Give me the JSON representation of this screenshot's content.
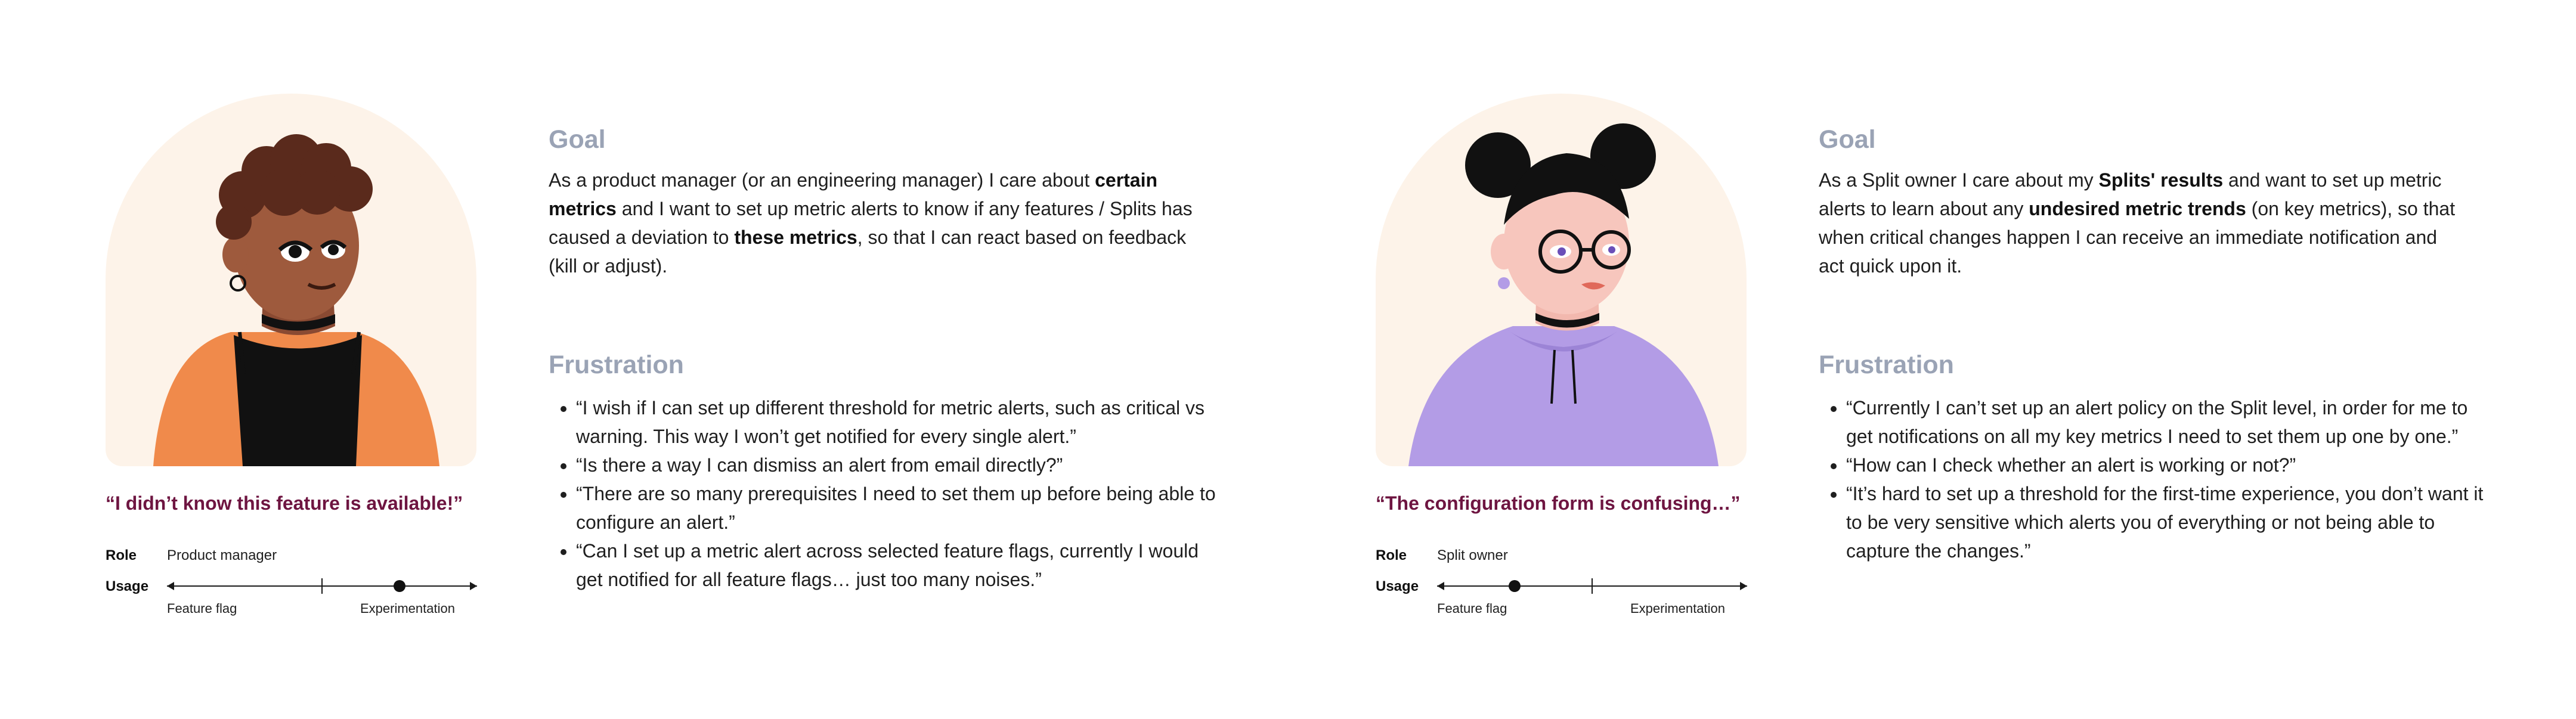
{
  "personas": [
    {
      "quote": "“I didn’t know this feature is available!”",
      "role_label": "Role",
      "role_value": "Product manager",
      "usage_label": "Usage",
      "usage_scale": {
        "left": "Feature flag",
        "right": "Experimentation",
        "position": 0.75
      },
      "goal_heading": "Goal",
      "goal_parts": {
        "t1": "As a product manager (or an engineering manager) I care about ",
        "b1": "certain metrics",
        "t2": " and I want to set up metric alerts to know if any features / Splits has caused a deviation to ",
        "b2": "these metrics",
        "t3": ", so that I can react based on feedback (kill or adjust)."
      },
      "frustration_heading": "Frustration",
      "frustrations": [
        "“I wish if I can set up different threshold for metric alerts, such as critical vs warning. This way I won’t get notified for every single alert.”",
        "“Is there a way I can dismiss an alert from email directly?”",
        "“There are so many prerequisites I need to set them up before being able to configure an alert.”",
        "“Can I set up a metric alert across selected feature flags, currently I would get notified for all feature flags… just too many noises.”"
      ]
    },
    {
      "quote": "“The configuration form is confusing…”",
      "role_label": "Role",
      "role_value": "Split owner",
      "usage_label": "Usage",
      "usage_scale": {
        "left": "Feature flag",
        "right": "Experimentation",
        "position": 0.25
      },
      "goal_heading": "Goal",
      "goal_parts": {
        "t1": "As a Split owner I care about my ",
        "b1": "Splits' results",
        "t2": " and want to set up metric alerts to learn about any ",
        "b2": "undesired metric trends",
        "t3": " (on key metrics), so that when critical changes happen I can receive an immediate notification and act quick upon it."
      },
      "frustration_heading": "Frustration",
      "frustrations": [
        "“Currently I can’t set up an alert policy on the Split level, in order for me to get notifications on all my key metrics I need to set them up one by one.”",
        "“How can I check whether an alert is working or not?”",
        "“It’s hard to set up a threshold for the first-time experience, you don’t want it to be very sensitive which alerts you of everything or not being able to capture the changes.”"
      ]
    }
  ],
  "colors": {
    "quote": "#6e1541",
    "heading": "#9aa3b5",
    "card_bg": "#fdf3e9",
    "shirt_orange": "#f08a4b",
    "hoodie_purple": "#b39ce6"
  }
}
